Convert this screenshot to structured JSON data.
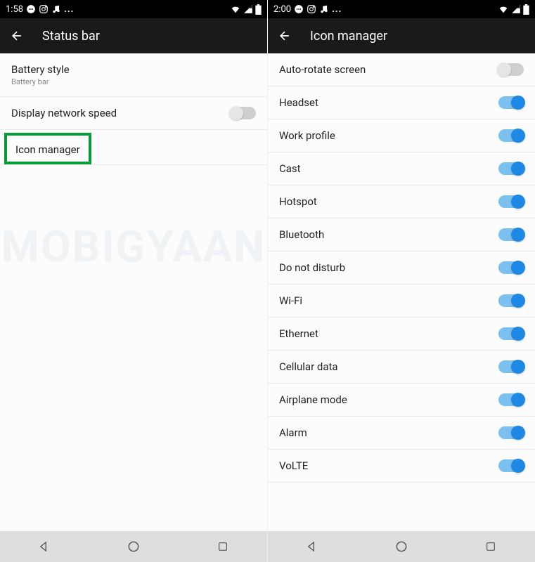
{
  "watermark": "MOBIGYAAN",
  "left": {
    "time": "1:58",
    "header": "Status bar",
    "items": [
      {
        "label": "Battery style",
        "sub": "Battery bar",
        "toggle": null
      },
      {
        "label": "Display network speed",
        "sub": null,
        "toggle": false
      },
      {
        "label": "Icon manager",
        "sub": null,
        "toggle": null,
        "highlight": true
      }
    ]
  },
  "right": {
    "time": "2:00",
    "header": "Icon manager",
    "items": [
      {
        "label": "Auto-rotate screen",
        "toggle": false
      },
      {
        "label": "Headset",
        "toggle": true
      },
      {
        "label": "Work profile",
        "toggle": true
      },
      {
        "label": "Cast",
        "toggle": true
      },
      {
        "label": "Hotspot",
        "toggle": true
      },
      {
        "label": "Bluetooth",
        "toggle": true
      },
      {
        "label": "Do not disturb",
        "toggle": true
      },
      {
        "label": "Wi-Fi",
        "toggle": true
      },
      {
        "label": "Ethernet",
        "toggle": true
      },
      {
        "label": "Cellular data",
        "toggle": true
      },
      {
        "label": "Airplane mode",
        "toggle": true
      },
      {
        "label": "Alarm",
        "toggle": true
      },
      {
        "label": "VoLTE",
        "toggle": true
      }
    ]
  }
}
